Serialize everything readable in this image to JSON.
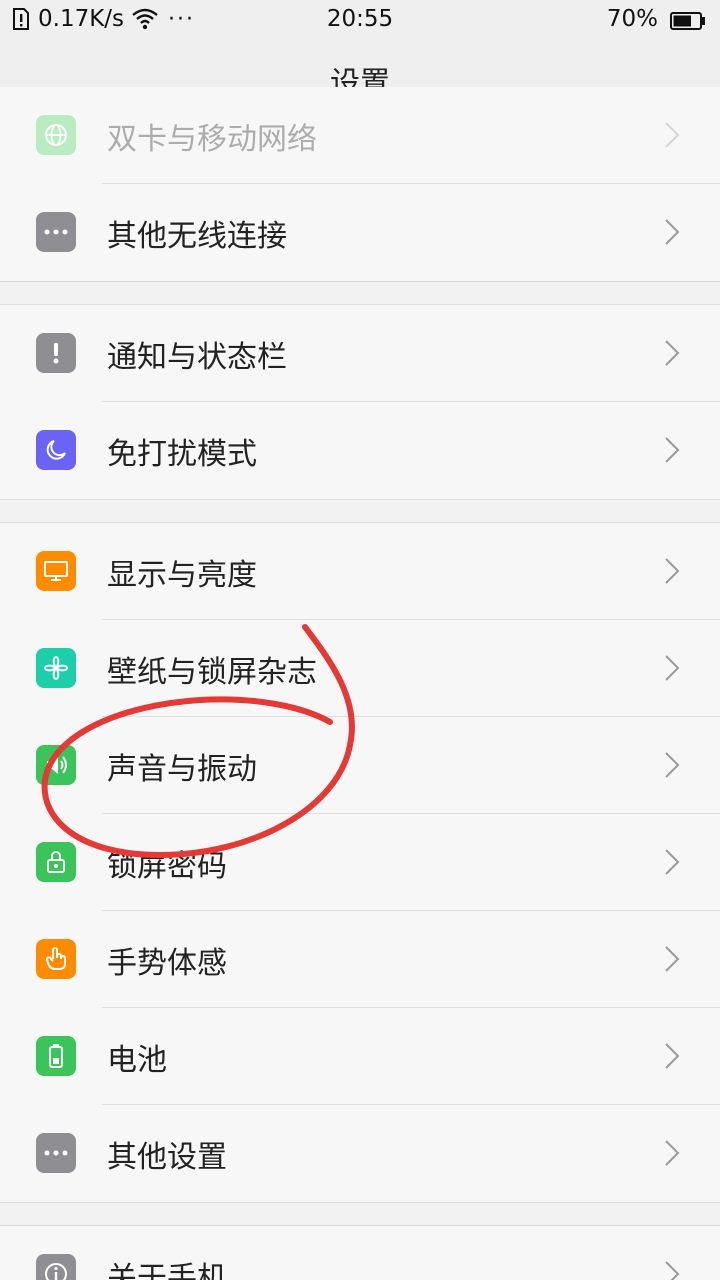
{
  "status_bar": {
    "speed": "0.17K/s",
    "dots": "···",
    "time": "20:55",
    "battery_percent": "70%",
    "battery_level": 0.7
  },
  "title": "设置",
  "groups": [
    {
      "items": [
        {
          "label": "双卡与移动网络",
          "icon": "globe-icon",
          "color": "#4cd964",
          "faded": true
        },
        {
          "label": "其他无线连接",
          "icon": "more-dots-icon",
          "color": "#8e8e93"
        }
      ]
    },
    {
      "items": [
        {
          "label": "通知与状态栏",
          "icon": "exclamation-icon",
          "color": "#8e8e93"
        },
        {
          "label": "免打扰模式",
          "icon": "moon-icon",
          "color": "#6b63f5"
        }
      ]
    },
    {
      "items": [
        {
          "label": "显示与亮度",
          "icon": "monitor-icon",
          "color": "#ff8c00"
        },
        {
          "label": "壁纸与锁屏杂志",
          "icon": "flower-icon",
          "color": "#1ccfa8"
        },
        {
          "label": "声音与振动",
          "icon": "sound-icon",
          "color": "#3ac45a"
        },
        {
          "label": "锁屏密码",
          "icon": "lock-icon",
          "color": "#3ac45a"
        },
        {
          "label": "手势体感",
          "icon": "hand-icon",
          "color": "#ff8c00"
        },
        {
          "label": "电池",
          "icon": "battery-icon",
          "color": "#3ac45a"
        },
        {
          "label": "其他设置",
          "icon": "more-dots-icon",
          "color": "#8e8e93"
        }
      ]
    },
    {
      "items": [
        {
          "label": "关于手机",
          "icon": "info-icon",
          "color": "#8e8e93"
        }
      ]
    }
  ],
  "annotation_color": "#e53935"
}
